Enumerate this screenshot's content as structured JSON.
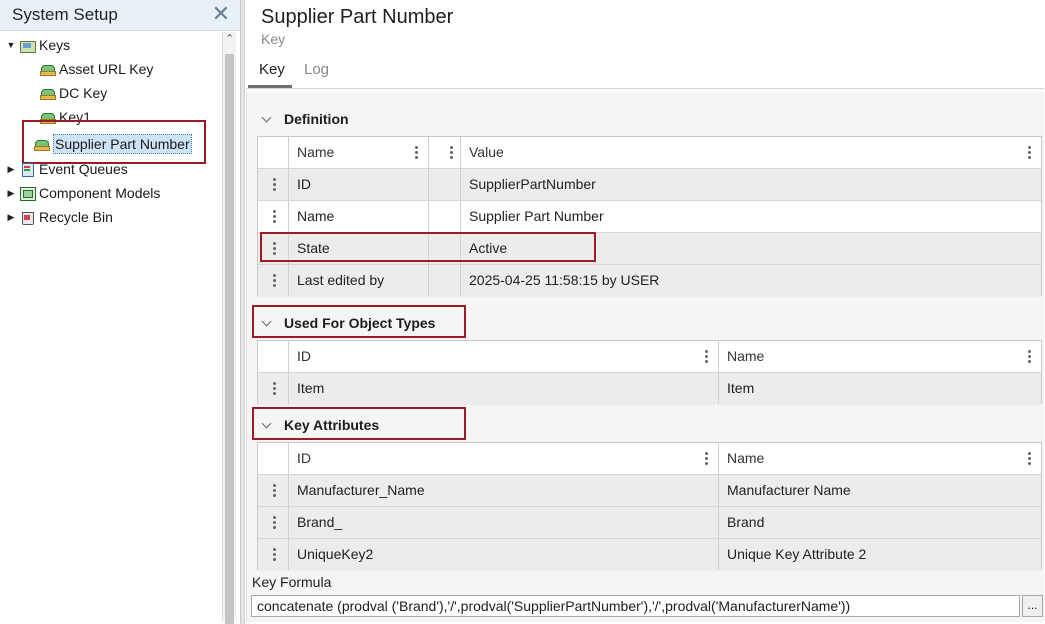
{
  "left_panel": {
    "title": "System Setup",
    "close_glyph": "✕",
    "tree": [
      {
        "label": "Keys",
        "icon": "keys-folder-icon",
        "expanded": true
      },
      {
        "label": "Asset URL Key",
        "icon": "key-icon"
      },
      {
        "label": "DC Key",
        "icon": "key-icon"
      },
      {
        "label": "Key1",
        "icon": "key-icon"
      },
      {
        "label": "Supplier Part Number",
        "icon": "key-icon",
        "selected": true
      },
      {
        "label": "Event Queues",
        "icon": "event-queue-icon"
      },
      {
        "label": "Component Models",
        "icon": "component-model-icon"
      },
      {
        "label": "Recycle Bin",
        "icon": "recycle-bin-icon"
      }
    ]
  },
  "header": {
    "title": "Supplier Part Number",
    "subtitle": "Key"
  },
  "tabs": [
    {
      "label": "Key",
      "active": true
    },
    {
      "label": "Log",
      "active": false
    }
  ],
  "definition": {
    "title": "Definition",
    "columns": [
      "Name",
      "Value"
    ],
    "rows": [
      {
        "name": "ID",
        "value": "SupplierPartNumber"
      },
      {
        "name": "Name",
        "value": "Supplier Part Number"
      },
      {
        "name": "State",
        "value": "Active"
      },
      {
        "name": "Last edited by",
        "value": "2025-04-25 11:58:15 by USER"
      }
    ]
  },
  "used_for": {
    "title": "Used For Object Types",
    "columns": [
      "ID",
      "Name"
    ],
    "rows": [
      {
        "id": "Item",
        "name": "Item"
      }
    ]
  },
  "key_attributes": {
    "title": "Key Attributes",
    "columns": [
      "ID",
      "Name"
    ],
    "rows": [
      {
        "id": "Manufacturer_Name",
        "name": "Manufacturer Name"
      },
      {
        "id": "Brand_",
        "name": "Brand"
      },
      {
        "id": "UniqueKey2",
        "name": "Unique Key Attribute 2"
      }
    ]
  },
  "formula": {
    "label": "Key Formula",
    "value": "concatenate (prodval ('Brand'),'/',prodval('SupplierPartNumber'),'/',prodval('ManufacturerName'))",
    "button_label": "..."
  },
  "colors": {
    "highlight_box": "#9b1c24",
    "selection": "#cde4f7",
    "header_bg": "#e8f0f8"
  }
}
